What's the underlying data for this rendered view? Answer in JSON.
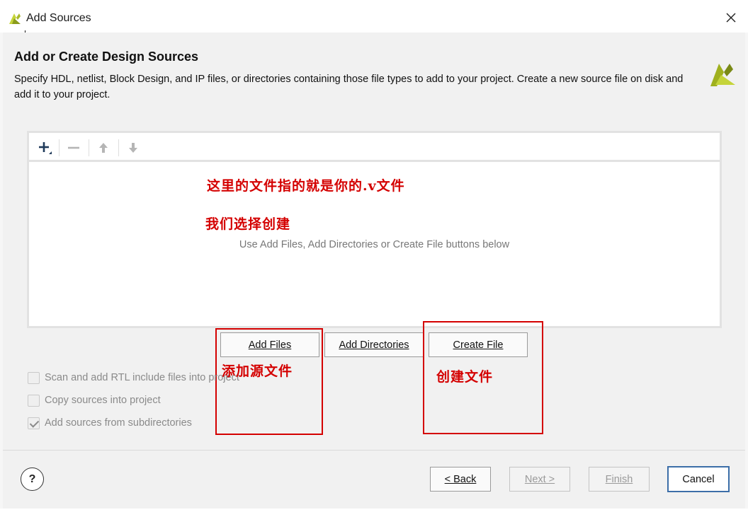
{
  "window": {
    "title": "Add Sources",
    "close_icon": "close-icon",
    "app_icon": "vivado-logo-icon"
  },
  "header": {
    "title": "Add or Create Design Sources",
    "description": "Specify HDL, netlist, Block Design, and IP files, or directories containing those file types to add to your project. Create a new source file on disk and add it to your project."
  },
  "toolbar": {
    "icons": [
      "add-icon",
      "remove-icon",
      "move-up-icon",
      "move-down-icon"
    ]
  },
  "file_list": {
    "empty_text": "Use Add Files, Add Directories or Create File buttons below"
  },
  "annotations": {
    "line1": "这里的文件指的就是你的.v文件",
    "line2": "我们选择创建",
    "add_files_note": "添加源文件",
    "create_file_note": "创建文件",
    "color": "#d40000"
  },
  "actions": {
    "add_files": "Add Files",
    "add_directories": "Add Directories",
    "create_file": "Create File"
  },
  "options": {
    "scan_rtl": {
      "label": "Scan and add RTL include files into project",
      "checked": false
    },
    "copy_sources": {
      "label": "Copy sources into project",
      "checked": false
    },
    "add_subdirs": {
      "label": "Add sources from subdirectories",
      "checked": true
    }
  },
  "footer": {
    "help": "?",
    "back": "< Back",
    "next": "Next >",
    "finish": "Finish",
    "cancel": "Cancel"
  },
  "colors": {
    "accent": "#3c6ea8",
    "logo_light": "#c5d43a",
    "logo_dark": "#7a8a16"
  }
}
